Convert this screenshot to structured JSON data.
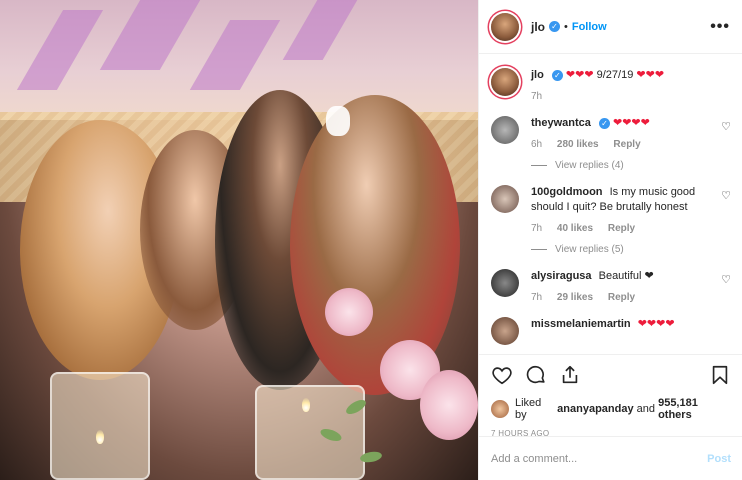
{
  "header": {
    "username": "jlo",
    "follow_label": "Follow",
    "separator": "•",
    "more_label": "•••"
  },
  "caption": {
    "username": "jlo",
    "hearts_before": "❤❤❤",
    "date_text": "9/27/19",
    "hearts_after": "❤❤❤",
    "time": "7h"
  },
  "comments": [
    {
      "username": "theywantca",
      "verified": true,
      "text": "❤❤❤❤",
      "time": "6h",
      "likes": "280 likes",
      "reply": "Reply",
      "view_replies": "View replies (4)"
    },
    {
      "username": "100goldmoon",
      "verified": false,
      "text": "Is my music good should I quit? Be brutally honest",
      "time": "7h",
      "likes": "40 likes",
      "reply": "Reply",
      "view_replies": "View replies (5)"
    },
    {
      "username": "alysiragusa",
      "verified": false,
      "text": "Beautiful ❤",
      "time": "7h",
      "likes": "29 likes",
      "reply": "Reply"
    },
    {
      "username": "missmelaniemartin",
      "verified": false,
      "text": "❤❤❤❤"
    }
  ],
  "actions": {
    "icons": [
      "heart-icon",
      "comment-icon",
      "share-icon",
      "bookmark-icon"
    ],
    "liked_prefix": "Liked by",
    "liked_user": "ananyapanday",
    "liked_and": "and",
    "liked_count": "955,181 others",
    "timestamp": "7 HOURS AGO"
  },
  "add_comment": {
    "placeholder": "Add a comment...",
    "post_label": "Post"
  },
  "colors": {
    "accent": "#0095f6",
    "verified": "#3897f0",
    "heart": "#ed1c3b",
    "post_disabled": "#b2dffc"
  }
}
